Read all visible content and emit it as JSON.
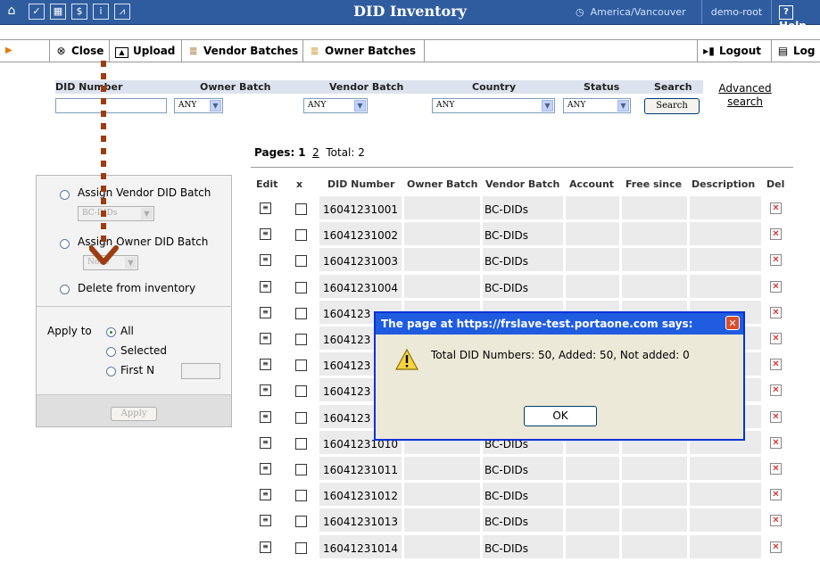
{
  "window": {
    "title": "DID Inventory",
    "timezone": "America/Vancouver",
    "user": "demo-root",
    "help": "Help"
  },
  "toolbar": {
    "close": "Close",
    "upload": "Upload",
    "vendor_batches": "Vendor Batches",
    "owner_batches": "Owner Batches",
    "logout": "Logout",
    "log": "Log"
  },
  "filter": {
    "headers": {
      "did_number": "DID Number",
      "owner_batch": "Owner Batch",
      "vendor_batch": "Vendor Batch",
      "country": "Country",
      "status": "Status",
      "search": "Search"
    },
    "did_value": "",
    "owner_batch": "ANY",
    "vendor_batch": "ANY",
    "country": "ANY",
    "status": "ANY",
    "search_button": "Search",
    "advanced_1": "Advanced",
    "advanced_2": "search"
  },
  "left": {
    "assign_vendor": "Assign Vendor DID Batch",
    "vendor_select": "BC-DIDs",
    "assign_owner": "Assign Owner DID Batch",
    "owner_select": "None",
    "delete": "Delete from inventory",
    "apply_to": "Apply to",
    "all": "All",
    "selected": "Selected",
    "first_n": "First N",
    "first_n_value": "",
    "apply_button": "Apply"
  },
  "pages": {
    "label": "Pages:",
    "current": "1",
    "other": "2",
    "total": "Total: 2"
  },
  "table": {
    "columns": {
      "edit": "Edit",
      "x": "x",
      "did": "DID Number",
      "owner": "Owner Batch",
      "vendor": "Vendor Batch",
      "account": "Account",
      "free_since": "Free since",
      "description": "Description",
      "del": "Del"
    },
    "rows": [
      {
        "did": "16041231001",
        "vendor": "BC-DIDs"
      },
      {
        "did": "16041231002",
        "vendor": "BC-DIDs"
      },
      {
        "did": "16041231003",
        "vendor": "BC-DIDs"
      },
      {
        "did": "16041231004",
        "vendor": "BC-DIDs"
      },
      {
        "did": "1604123",
        "vendor": ""
      },
      {
        "did": "1604123",
        "vendor": ""
      },
      {
        "did": "1604123",
        "vendor": ""
      },
      {
        "did": "1604123",
        "vendor": ""
      },
      {
        "did": "1604123",
        "vendor": ""
      },
      {
        "did": "16041231010",
        "vendor": "BC-DIDs"
      },
      {
        "did": "16041231011",
        "vendor": "BC-DIDs"
      },
      {
        "did": "16041231012",
        "vendor": "BC-DIDs"
      },
      {
        "did": "16041231013",
        "vendor": "BC-DIDs"
      },
      {
        "did": "16041231014",
        "vendor": "BC-DIDs"
      }
    ]
  },
  "dialog": {
    "title": "The page at https://frslave-test.portaone.com says:",
    "message": "Total DID Numbers: 50, Added: 50, Not added: 0",
    "ok": "OK"
  },
  "colors": {
    "header_blue": "#2f5c9f",
    "annotation_brown": "#9c3c10",
    "dialog_blue": "#1f5ce0"
  },
  "icons": [
    "home-icon",
    "check-icon",
    "grid-icon",
    "dollar-icon",
    "info-icon",
    "chart-icon",
    "clock-icon",
    "help-icon",
    "close-icon",
    "upload-icon",
    "vendor-batches-icon",
    "owner-batches-icon",
    "logout-icon",
    "log-icon",
    "edit-icon",
    "delete-icon",
    "warning-icon"
  ]
}
